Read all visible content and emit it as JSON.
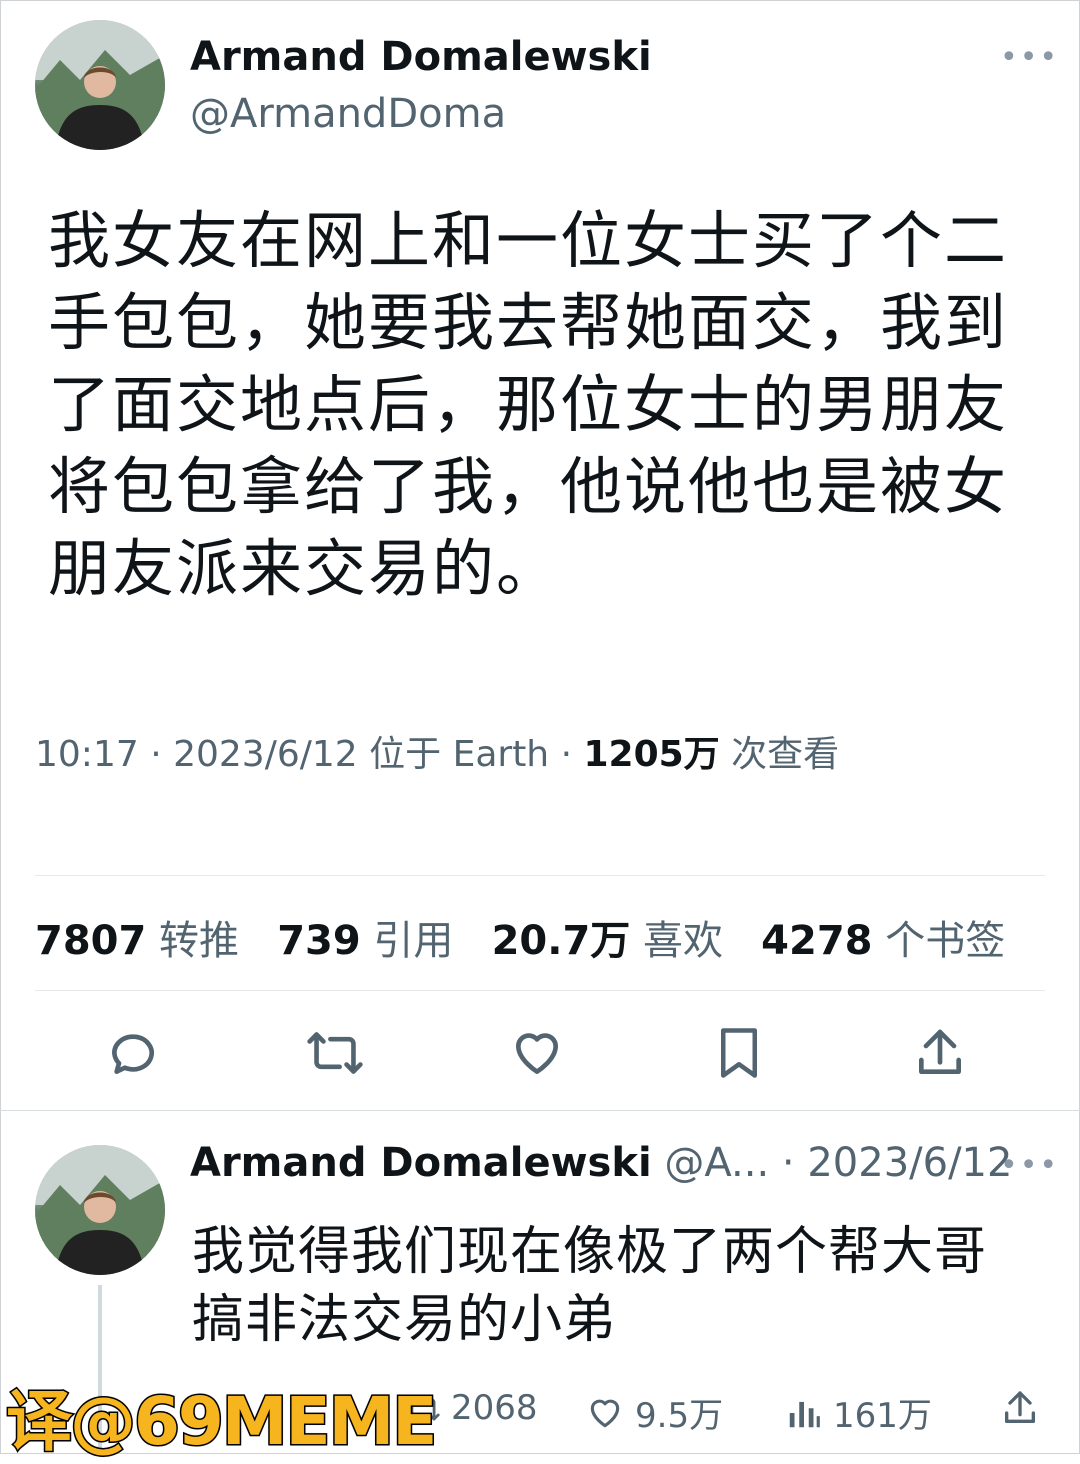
{
  "main_tweet": {
    "author_name": "Armand Domalewski",
    "author_handle": "@ArmandDoma",
    "text": "我女友在网上和一位女士买了个二手包包，她要我去帮她面交，我到了面交地点后，那位女士的男朋友将包包拿给了我，他说他也是被女朋友派来交易的。",
    "time": "10:17",
    "date": "2023/6/12",
    "location": "位于 Earth",
    "views_value": "1205万",
    "views_label": "次查看",
    "stats": [
      {
        "value": "7807",
        "label": "转推"
      },
      {
        "value": "739",
        "label": "引用"
      },
      {
        "value": "20.7万",
        "label": "喜欢"
      },
      {
        "value": "4278",
        "label": "个书签"
      }
    ],
    "actions": [
      "reply-icon",
      "retweet-icon",
      "like-icon",
      "bookmark-icon",
      "share-icon"
    ]
  },
  "reply_tweet": {
    "author_name": "Armand Domalewski",
    "author_handle": "@A...",
    "date": "2023/6/12",
    "text": "我觉得我们现在像极了两个帮大哥搞非法交易的小弟",
    "retweets": "2068",
    "likes": "9.5万",
    "views": "161万"
  },
  "watermark": "译@69MEME",
  "colors": {
    "text": "#0f1419",
    "secondary": "#536471",
    "divider": "#e6e9eb",
    "watermark": "#f6b51e"
  }
}
